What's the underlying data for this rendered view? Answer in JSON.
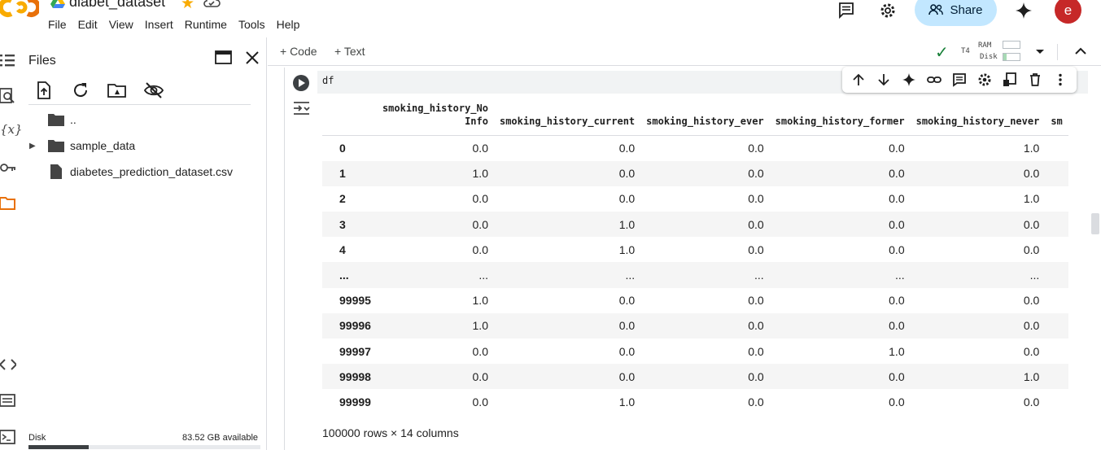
{
  "header": {
    "notebook_title": "diabet_dataset",
    "menu": [
      "File",
      "Edit",
      "View",
      "Insert",
      "Runtime",
      "Tools",
      "Help"
    ],
    "share_label": "Share",
    "avatar_initial": "e"
  },
  "files_panel": {
    "title": "Files",
    "items": [
      {
        "name": "..",
        "type": "folder-parent"
      },
      {
        "name": "sample_data",
        "type": "folder"
      },
      {
        "name": "diabetes_prediction_dataset.csv",
        "type": "file"
      }
    ],
    "disk_label": "Disk",
    "disk_available": "83.52 GB available",
    "disk_used_fraction": 0.26
  },
  "toolbar": {
    "code_label": "+ Code",
    "text_label": "+ Text",
    "runtime": "T4",
    "ram_label": "RAM",
    "disk_label": "Disk",
    "ram_fraction": 0.0,
    "disk_fraction": 0.2
  },
  "cell": {
    "code": "df",
    "columns": [
      "smoking_history_No Info",
      "smoking_history_current",
      "smoking_history_ever",
      "smoking_history_former",
      "smoking_history_never",
      "sm"
    ],
    "column_header_lines": [
      [
        "smoking_history_No",
        "Info"
      ],
      [
        "smoking_history_current"
      ],
      [
        "smoking_history_ever"
      ],
      [
        "smoking_history_former"
      ],
      [
        "smoking_history_never"
      ],
      [
        "sm"
      ]
    ],
    "rows": [
      {
        "index": "0",
        "values": [
          "0.0",
          "0.0",
          "0.0",
          "0.0",
          "1.0"
        ]
      },
      {
        "index": "1",
        "values": [
          "1.0",
          "0.0",
          "0.0",
          "0.0",
          "0.0"
        ]
      },
      {
        "index": "2",
        "values": [
          "0.0",
          "0.0",
          "0.0",
          "0.0",
          "1.0"
        ]
      },
      {
        "index": "3",
        "values": [
          "0.0",
          "1.0",
          "0.0",
          "0.0",
          "0.0"
        ]
      },
      {
        "index": "4",
        "values": [
          "0.0",
          "1.0",
          "0.0",
          "0.0",
          "0.0"
        ]
      },
      {
        "index": "...",
        "values": [
          "...",
          "...",
          "...",
          "...",
          "..."
        ]
      },
      {
        "index": "99995",
        "values": [
          "1.0",
          "0.0",
          "0.0",
          "0.0",
          "0.0"
        ]
      },
      {
        "index": "99996",
        "values": [
          "1.0",
          "0.0",
          "0.0",
          "0.0",
          "0.0"
        ]
      },
      {
        "index": "99997",
        "values": [
          "0.0",
          "0.0",
          "0.0",
          "1.0",
          "0.0"
        ]
      },
      {
        "index": "99998",
        "values": [
          "0.0",
          "0.0",
          "0.0",
          "0.0",
          "1.0"
        ]
      },
      {
        "index": "99999",
        "values": [
          "0.0",
          "1.0",
          "0.0",
          "0.0",
          "0.0"
        ]
      }
    ],
    "footer": "100000 rows × 14 columns"
  },
  "colors": {
    "accent": "#f9ab00",
    "share_bg": "#c2e7ff",
    "avatar_bg": "#c62828",
    "status_ok": "#188038"
  },
  "icons": {
    "left_rail": [
      "toc-icon",
      "find-icon",
      "variables-icon",
      "secrets-icon",
      "files-icon",
      "code-snippets-icon",
      "command-palette-icon",
      "terminal-icon"
    ],
    "cell_toolbar": [
      "move-up-icon",
      "move-down-icon",
      "gemini-icon",
      "link-icon",
      "comment-icon",
      "settings-icon",
      "mirror-cell-icon",
      "delete-icon",
      "more-icon"
    ]
  }
}
